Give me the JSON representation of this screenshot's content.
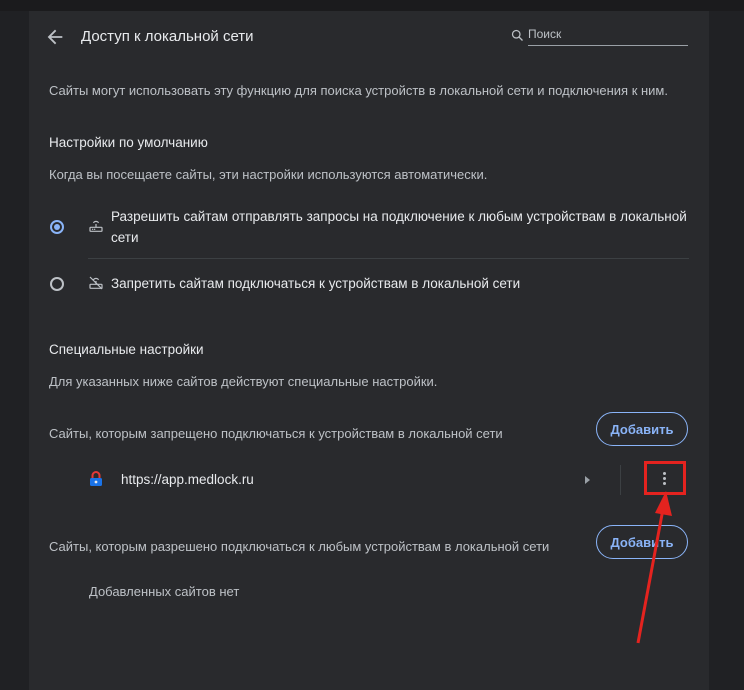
{
  "header": {
    "title": "Доступ к локальной сети",
    "search_placeholder": "Поиск"
  },
  "intro": "Сайты могут использовать эту функцию для поиска устройств в локальной сети и подключения к ним.",
  "defaults": {
    "heading": "Настройки по умолчанию",
    "description": "Когда вы посещаете сайты, эти настройки используются автоматически.",
    "options": [
      {
        "label_line1": "Разрешить сайтам отправлять запросы на подключение к любым устройствам в локальной",
        "label_line2": "сети",
        "selected": true,
        "icon": "lan-router-icon"
      },
      {
        "label_line1": "Запретить сайтам подключаться к устройствам в локальной сети",
        "selected": false,
        "icon": "lan-router-off-icon"
      }
    ]
  },
  "custom": {
    "heading": "Специальные настройки",
    "description": "Для указанных ниже сайтов действуют специальные настройки.",
    "blocked": {
      "label": "Сайты, которым запрещено подключаться к устройствам в локальной сети",
      "add_label": "Добавить",
      "sites": [
        {
          "url": "https://app.medlock.ru",
          "icon": "padlock-icon"
        }
      ]
    },
    "allowed": {
      "label": "Сайты, которым разрешено подключаться к любым устройствам в локальной сети",
      "add_label": "Добавить",
      "empty_text": "Добавленных сайтов нет"
    }
  },
  "colors": {
    "accent": "#8ab4f8",
    "panel_bg": "#292a2d",
    "annotation": "#e4231f"
  }
}
